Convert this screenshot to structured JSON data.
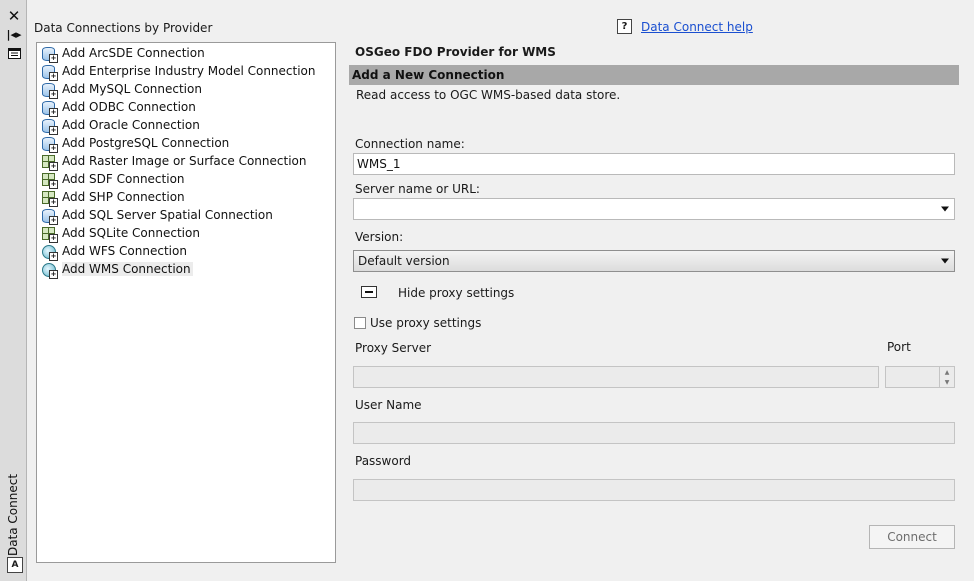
{
  "palette": {
    "title": "Data Connect",
    "close_icon": "close-icon",
    "autohide_icon": "autohide-icon",
    "properties_icon": "properties-icon",
    "a_icon_label": "A"
  },
  "left_panel": {
    "title": "Data Connections by Provider",
    "items": [
      {
        "label": "Add ArcSDE Connection",
        "icon": "db"
      },
      {
        "label": "Add Enterprise Industry Model Connection",
        "icon": "db"
      },
      {
        "label": "Add MySQL Connection",
        "icon": "db"
      },
      {
        "label": "Add ODBC Connection",
        "icon": "db"
      },
      {
        "label": "Add Oracle Connection",
        "icon": "db"
      },
      {
        "label": "Add PostgreSQL Connection",
        "icon": "db"
      },
      {
        "label": "Add Raster Image or Surface Connection",
        "icon": "grid"
      },
      {
        "label": "Add SDF Connection",
        "icon": "grid"
      },
      {
        "label": "Add SHP Connection",
        "icon": "grid"
      },
      {
        "label": "Add SQL Server Spatial Connection",
        "icon": "db"
      },
      {
        "label": "Add SQLite Connection",
        "icon": "grid"
      },
      {
        "label": "Add WFS Connection",
        "icon": "globe"
      },
      {
        "label": "Add WMS Connection",
        "icon": "globe",
        "selected": true
      }
    ]
  },
  "right_panel": {
    "help_link": "Data Connect help",
    "help_icon_glyph": "?",
    "provider_title": "OSGeo FDO Provider for WMS",
    "section_title": "Add a New Connection",
    "description": "Read access to OGC WMS-based data store.",
    "connection_name_label": "Connection name:",
    "connection_name_value": "WMS_1",
    "server_label": "Server name or URL:",
    "server_value": "",
    "version_label": "Version:",
    "version_value": "Default version",
    "proxy_toggle_label": "Hide proxy settings",
    "use_proxy_label": "Use proxy settings",
    "use_proxy_checked": false,
    "proxy_server_label": "Proxy Server",
    "proxy_server_value": "",
    "port_label": "Port",
    "port_value": "",
    "user_name_label": "User Name",
    "user_name_value": "",
    "password_label": "Password",
    "password_value": "",
    "connect_button": "Connect"
  }
}
